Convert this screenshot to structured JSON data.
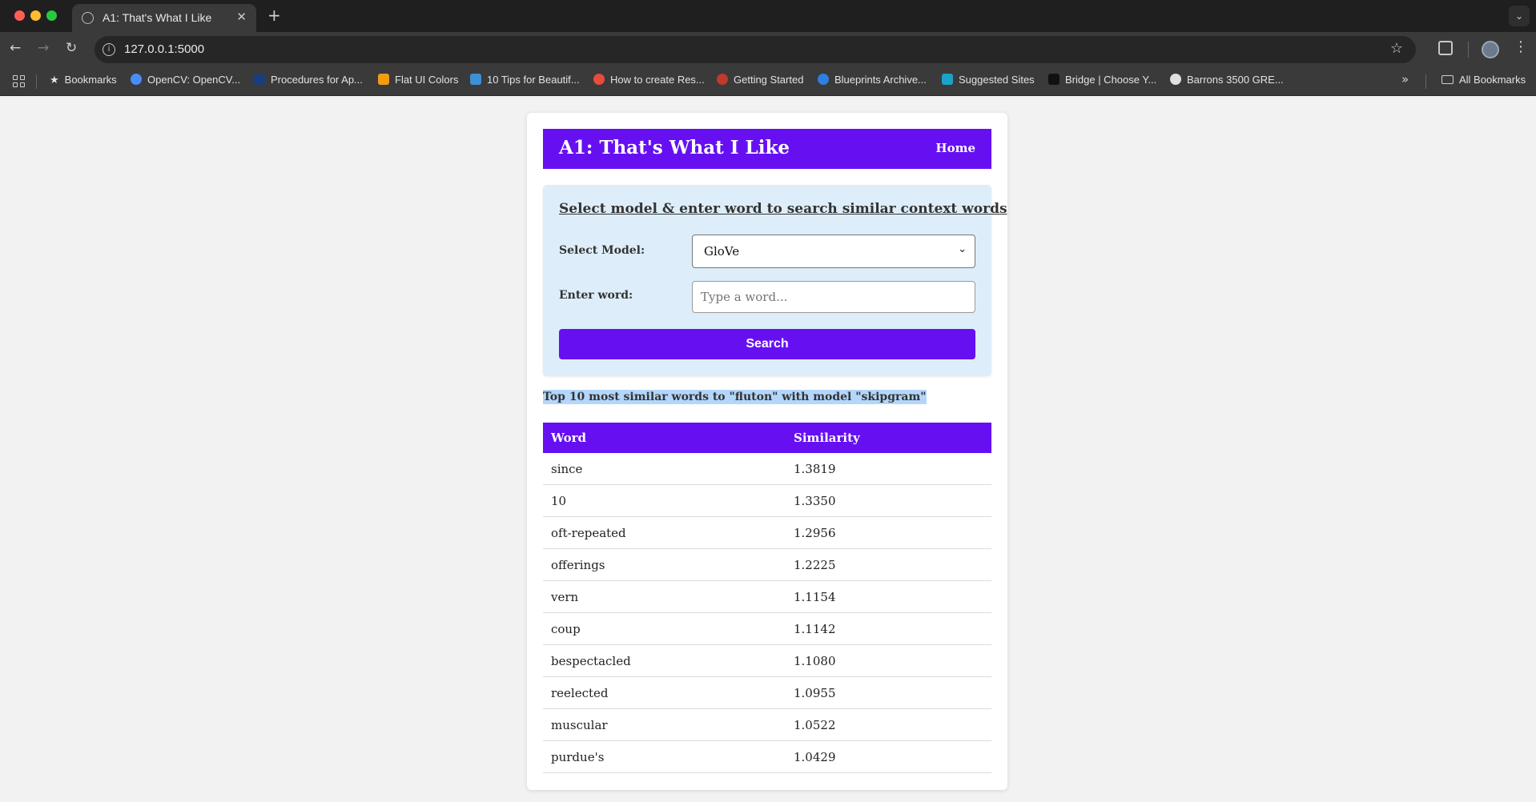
{
  "browser": {
    "tab_title": "A1: That's What I Like",
    "url": "127.0.0.1:5000",
    "bookmarks": [
      {
        "label": "Bookmarks",
        "color": "#cfcfcf"
      },
      {
        "label": "OpenCV: OpenCV...",
        "color": "#4a8cf7"
      },
      {
        "label": "Procedures for Ap...",
        "color": "#1c3d7a"
      },
      {
        "label": "Flat UI Colors",
        "color": "#f39c12"
      },
      {
        "label": "10 Tips for Beautif...",
        "color": "#3d8fd6"
      },
      {
        "label": "How to create Res...",
        "color": "#e74c3c"
      },
      {
        "label": "Getting Started",
        "color": "#c0392b"
      },
      {
        "label": "Blueprints Archive...",
        "color": "#2f7fe0"
      },
      {
        "label": "Suggested Sites",
        "color": "#1aa3c9"
      },
      {
        "label": "Bridge | Choose Y...",
        "color": "#111111"
      },
      {
        "label": "Barrons 3500 GRE...",
        "color": "#e0e0e0"
      }
    ],
    "all_bookmarks": "All Bookmarks"
  },
  "header": {
    "title": "A1: That's What I Like",
    "home": "Home"
  },
  "search": {
    "heading": "Select model & enter word to search similar context words",
    "model_label": "Select Model:",
    "model_value": "GloVe",
    "word_label": "Enter word:",
    "word_placeholder": "Type a word...",
    "word_value": "",
    "button": "Search"
  },
  "results": {
    "heading": "Top 10 most similar words to \"fluton\" with model \"skipgram\"",
    "columns": [
      "Word",
      "Similarity"
    ],
    "rows": [
      [
        "since",
        "1.3819"
      ],
      [
        "10",
        "1.3350"
      ],
      [
        "oft-repeated",
        "1.2956"
      ],
      [
        "offerings",
        "1.2225"
      ],
      [
        "vern",
        "1.1154"
      ],
      [
        "coup",
        "1.1142"
      ],
      [
        "bespectacled",
        "1.1080"
      ],
      [
        "reelected",
        "1.0955"
      ],
      [
        "muscular",
        "1.0522"
      ],
      [
        "purdue's",
        "1.0429"
      ]
    ]
  },
  "colors": {
    "accent": "#6610f2",
    "panel_bg": "#ddeefa",
    "selection": "#b4d6fb"
  }
}
